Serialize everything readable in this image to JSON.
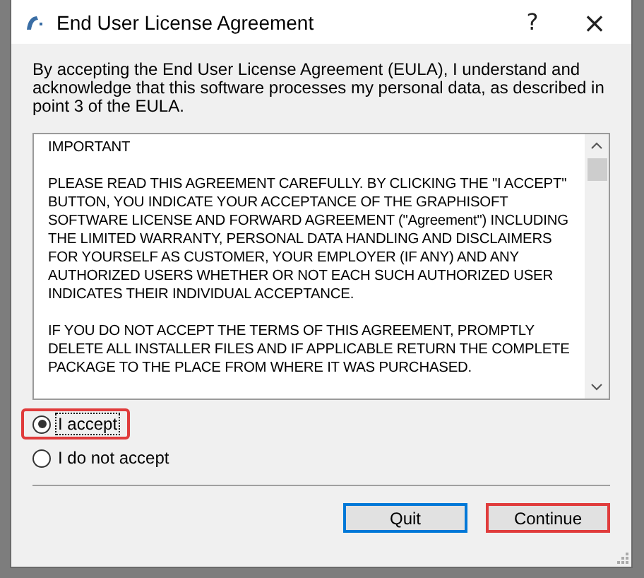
{
  "window": {
    "title": "End User License Agreement",
    "help": "?",
    "close": "×"
  },
  "intro": "By accepting the End User License Agreement (EULA), I understand and acknowledge that this software processes my personal data, as described in point 3 of the EULA.",
  "license_text": [
    "IMPORTANT",
    "PLEASE READ THIS AGREEMENT CAREFULLY. BY CLICKING THE \"I ACCEPT\" BUTTON, YOU INDICATE YOUR ACCEPTANCE OF THE GRAPHISOFT SOFTWARE LICENSE AND FORWARD AGREEMENT (\"Agreement\") INCLUDING THE LIMITED WARRANTY, PERSONAL DATA HANDLING AND DISCLAIMERS FOR YOURSELF AS CUSTOMER, YOUR EMPLOYER (IF ANY) AND ANY AUTHORIZED USERS WHETHER OR NOT EACH SUCH AUTHORIZED USER INDICATES THEIR INDIVIDUAL ACCEPTANCE.",
    "IF YOU DO NOT ACCEPT THE TERMS OF THIS AGREEMENT, PROMPTLY DELETE ALL INSTALLER FILES AND IF APPLICABLE RETURN THE COMPLETE PACKAGE TO THE PLACE FROM WHERE IT WAS PURCHASED."
  ],
  "options": [
    {
      "label": "I accept",
      "selected": true,
      "highlighted": true
    },
    {
      "label": "I do not accept",
      "selected": false,
      "highlighted": false
    }
  ],
  "buttons": [
    {
      "label": "Quit",
      "focused": true,
      "highlighted": false
    },
    {
      "label": "Continue",
      "focused": false,
      "highlighted": true
    }
  ]
}
